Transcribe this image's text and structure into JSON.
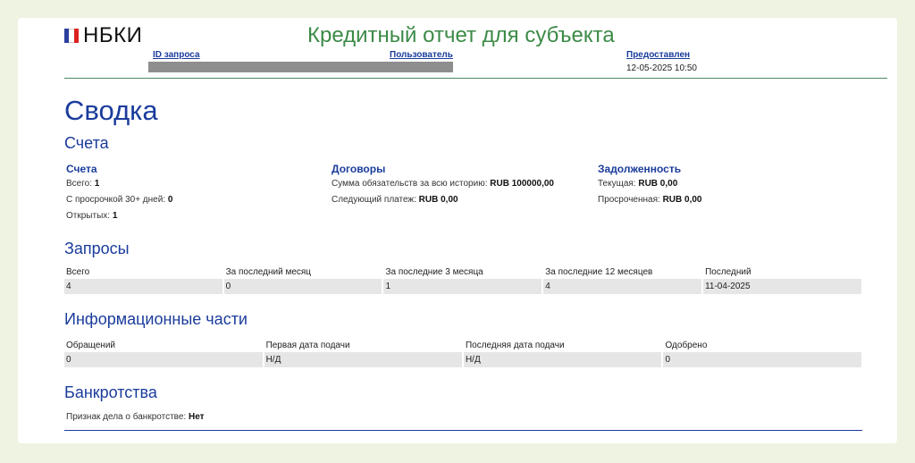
{
  "brand": {
    "name": "НБКИ"
  },
  "report_title": "Кредитный отчет для субъекта",
  "header": {
    "request_id_label": "ID запроса",
    "user_label": "Пользователь",
    "provided_label": "Предоставлен",
    "provided_value": "12-05-2025 10:50"
  },
  "summary": {
    "title": "Сводка",
    "accounts_section_title": "Счета",
    "accounts": {
      "title": "Счета",
      "total_label": "Всего:",
      "total_value": "1",
      "overdue_label": "С просрочкой 30+ дней:",
      "overdue_value": "0",
      "open_label": "Открытых:",
      "open_value": "1"
    },
    "contracts": {
      "title": "Договоры",
      "history_label": "Сумма обязательств за всю историю:",
      "history_value": "RUB 100000,00",
      "next_payment_label": "Следующий платеж:",
      "next_payment_value": "RUB 0,00"
    },
    "debt": {
      "title": "Задолженность",
      "current_label": "Текущая:",
      "current_value": "RUB 0,00",
      "overdue_label": "Просроченная:",
      "overdue_value": "RUB 0,00"
    }
  },
  "inquiries": {
    "title": "Запросы",
    "columns": [
      "Всего",
      "За последний месяц",
      "За последние 3 месяца",
      "За последние 12 месяцев",
      "Последний"
    ],
    "values": [
      "4",
      "0",
      "1",
      "4",
      "11-04-2025"
    ]
  },
  "info_parts": {
    "title": "Информационные части",
    "columns": [
      "Обращений",
      "Первая дата подачи",
      "Последняя дата подачи",
      "Одобрено"
    ],
    "values": [
      "0",
      "Н/Д",
      "Н/Д",
      "0"
    ]
  },
  "bankruptcy": {
    "title": "Банкротства",
    "label": "Признак дела о банкротстве:",
    "value": "Нет"
  },
  "colors": {
    "background": "#eef3e2",
    "heading_blue": "#1a3c9c",
    "title_green": "#3c8a47",
    "table_cell": "#e6e6e6"
  }
}
